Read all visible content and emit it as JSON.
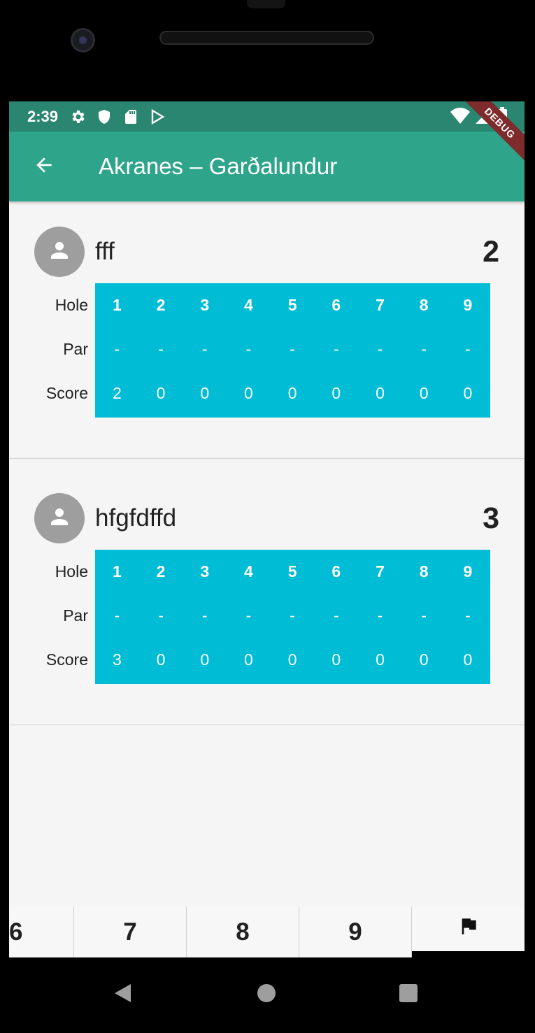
{
  "status_bar": {
    "time": "2:39",
    "icons": [
      "gear-icon",
      "shield-icon",
      "sd-card-icon",
      "play-store-icon"
    ],
    "right_icons": [
      "wifi-icon",
      "signal-icon",
      "battery-icon"
    ]
  },
  "debug_banner": "DEBUG",
  "app_bar": {
    "title": "Akranes – Garðalundur",
    "back_icon": "arrow-back-icon",
    "color": "#2ea58a"
  },
  "row_labels": {
    "hole": "Hole",
    "par": "Par",
    "score": "Score"
  },
  "grid_color": "#00bcd4",
  "players": [
    {
      "name": "fff",
      "total": "2",
      "holes": [
        "1",
        "2",
        "3",
        "4",
        "5",
        "6",
        "7",
        "8",
        "9"
      ],
      "par": [
        "-",
        "-",
        "-",
        "-",
        "-",
        "-",
        "-",
        "-",
        "-"
      ],
      "score": [
        "2",
        "0",
        "0",
        "0",
        "0",
        "0",
        "0",
        "0",
        "0"
      ]
    },
    {
      "name": "hfgfdffd",
      "total": "3",
      "holes": [
        "1",
        "2",
        "3",
        "4",
        "5",
        "6",
        "7",
        "8",
        "9"
      ],
      "par": [
        "-",
        "-",
        "-",
        "-",
        "-",
        "-",
        "-",
        "-",
        "-"
      ],
      "score": [
        "3",
        "0",
        "0",
        "0",
        "0",
        "0",
        "0",
        "0",
        "0"
      ]
    }
  ],
  "keypad": {
    "keys": [
      "6",
      "7",
      "8",
      "9"
    ],
    "flag_icon": "flag-icon"
  },
  "nav_bar": [
    "back-triangle-icon",
    "home-circle-icon",
    "recents-square-icon"
  ]
}
